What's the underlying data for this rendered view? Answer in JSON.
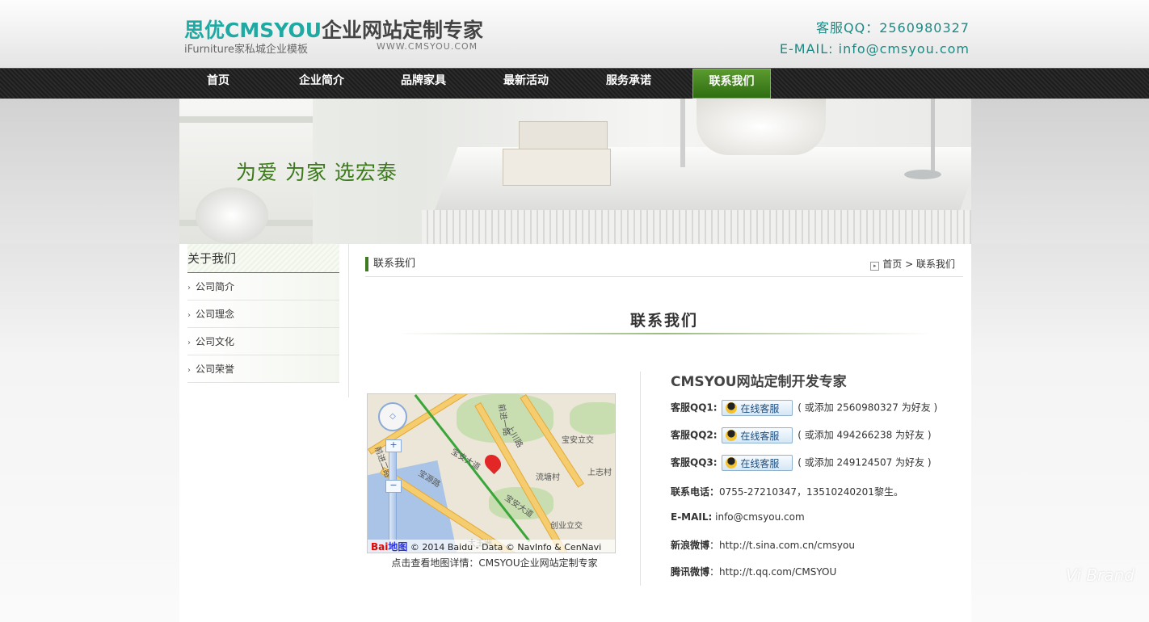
{
  "header": {
    "logo_brand_cn": "思优",
    "logo_brand_en": "CMSYOU",
    "logo_slogan": "企业网站定制专家",
    "logo_sub": "iFurniture家私城企业模板",
    "logo_url": "WWW.CMSYOU.COM",
    "service_qq": "客服QQ：2560980327",
    "email": "E-MAIL: info@cmsyou.com"
  },
  "nav": {
    "items": [
      "首页",
      "企业简介",
      "品牌家具",
      "最新活动",
      "服务承诺",
      "联系我们"
    ],
    "active": "联系我们"
  },
  "banner": {
    "slogan": "为爱 为家 选宏泰"
  },
  "sidebar": {
    "title": "关于我们",
    "items": [
      "公司简介",
      "公司理念",
      "公司文化",
      "公司荣誉"
    ]
  },
  "breadcrumb": {
    "title": "联系我们",
    "home": "首页",
    "sep": ">",
    "current": "联系我们"
  },
  "content": {
    "heading": "联系我们",
    "map": {
      "labels": [
        "宝安立交",
        "上志村",
        "流塘村",
        "创业立交",
        "宝安大道",
        "宝源路",
        "大王洲",
        "前进一路",
        "前进二路",
        "上川路",
        "宝安大道"
      ],
      "footer_text": "© 2014 Baidu - Data © NavInfo & CenNavi",
      "logo_text": "Bai",
      "logo_text2": "地图",
      "caption": "点击查看地图详情：CMSYOU企业网站定制专家"
    },
    "info": {
      "title": "CMSYOU网站定制开发专家",
      "qq_button": "在线客服",
      "qq_rows": [
        {
          "label": "客服QQ1:",
          "note": "( 或添加 2560980327 为好友 )"
        },
        {
          "label": "客服QQ2:",
          "note": "( 或添加 494266238 为好友 )"
        },
        {
          "label": "客服QQ3:",
          "note": "( 或添加 249124507 为好友 )"
        }
      ],
      "phone_label": "联系电话：",
      "phone_value": "0755-27210347，13510240201黎生。",
      "email_label": "E-MAIL:",
      "email_value": " info@cmsyou.com",
      "sina_label": "新浪微博",
      "sina_value": "：http://t.sina.com.cn/cmsyou",
      "tencent_label": "腾讯微博",
      "tencent_value": "：http://t.qq.com/CMSYOU"
    }
  },
  "watermark": "Vi Brand",
  "colors": {
    "brand_teal": "#1fa9a3",
    "nav_active": "#3f7f1d",
    "slogan_green": "#3d7a1c"
  }
}
